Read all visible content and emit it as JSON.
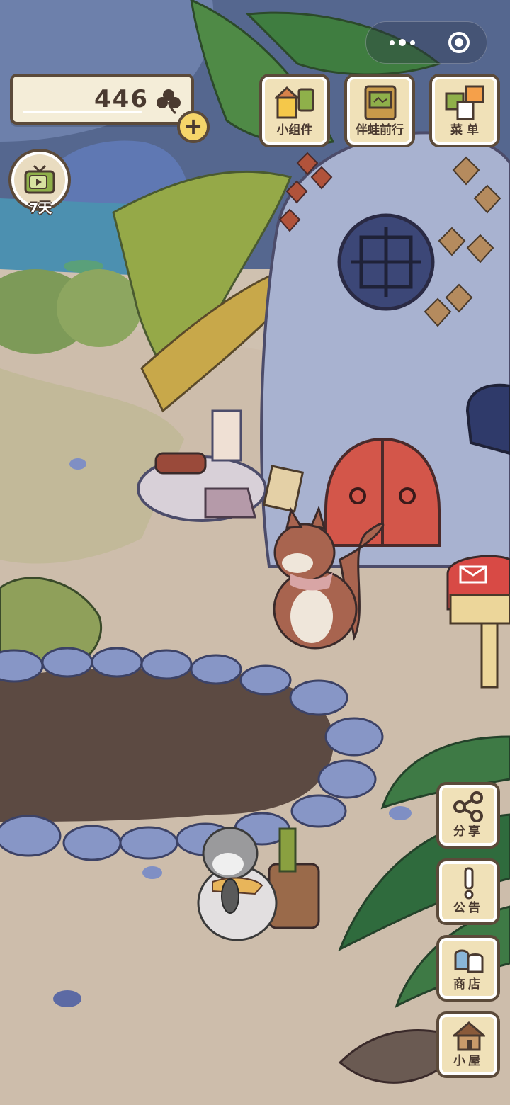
{
  "currency": {
    "amount": "446",
    "icon": "clover-icon"
  },
  "capsule": {
    "more_icon": "more-dots-icon",
    "close_icon": "target-icon"
  },
  "top_buttons": [
    {
      "label": "小组件",
      "icon": "widget-icon"
    },
    {
      "label": "伴蛙前行",
      "icon": "album-icon"
    },
    {
      "label": "菜 单",
      "icon": "menu-cards-icon"
    }
  ],
  "tv": {
    "label": "7天",
    "icon": "tv-icon"
  },
  "side_buttons": [
    {
      "label": "分享",
      "icon": "share-icon"
    },
    {
      "label": "公告",
      "icon": "exclamation-icon"
    },
    {
      "label": "商店",
      "icon": "shop-bags-icon"
    },
    {
      "label": "小屋",
      "icon": "house-icon"
    }
  ],
  "colors": {
    "frame": "#5b4a3a",
    "button_fill": "#f0e1b8",
    "coin_plus": "#f5d56a",
    "mailbox": "#d84a45",
    "door": "#d3564a"
  }
}
